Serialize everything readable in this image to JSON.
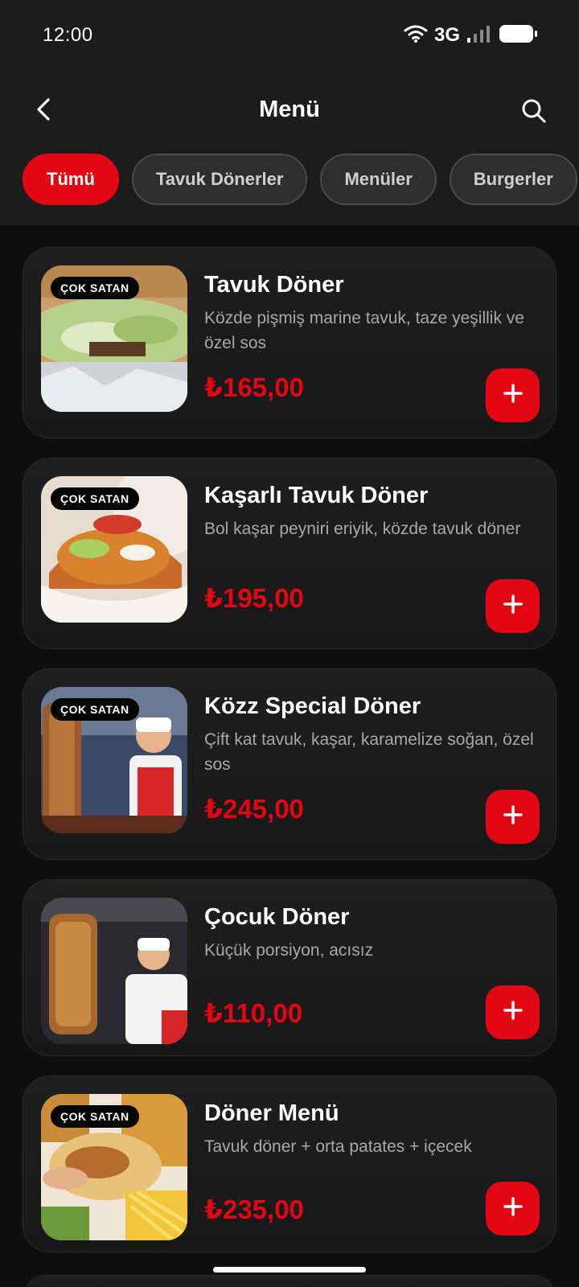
{
  "status": {
    "time": "12:00",
    "network": "3G"
  },
  "header": {
    "title": "Menü"
  },
  "categories": [
    "Tümü",
    "Tavuk Dönerler",
    "Menüler",
    "Burgerler"
  ],
  "products": [
    {
      "name": "Tavuk Döner",
      "description": "Közde pişmiş marine tavuk, taze yeşillik ve özel sos",
      "price": "₺165,00",
      "badge": "ÇOK SATAN"
    },
    {
      "name": "Kaşarlı Tavuk Döner",
      "description": "Bol kaşar peyniri eriyik, közde tavuk döner",
      "price": "₺195,00",
      "badge": "ÇOK SATAN"
    },
    {
      "name": "Közz Special Döner",
      "description": "Çift kat tavuk, kaşar, karamelize soğan, özel sos",
      "price": "₺245,00",
      "badge": "ÇOK SATAN"
    },
    {
      "name": "Çocuk Döner",
      "description": "Küçük porsiyon, acısız",
      "price": "₺110,00",
      "badge": ""
    },
    {
      "name": "Döner Menü",
      "description": "Tavuk döner + orta patates + içecek",
      "price": "₺235,00",
      "badge": "ÇOK SATAN"
    }
  ],
  "colors": {
    "accent": "#e30613",
    "background": "#0f0f0f",
    "card": "#1c1c1c"
  }
}
